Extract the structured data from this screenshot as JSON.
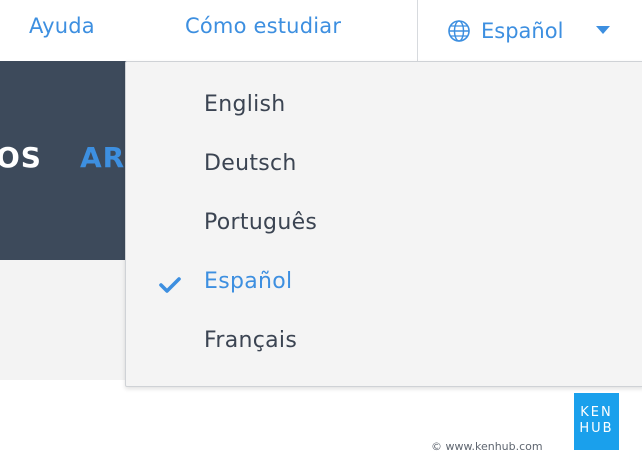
{
  "nav": {
    "items": [
      {
        "label": "Ayuda"
      },
      {
        "label": "Cómo estudiar"
      }
    ],
    "language_button": {
      "label": "Español",
      "icon": "globe-icon",
      "caret_icon": "caret-down-icon"
    }
  },
  "hero": {
    "text_left": "OS",
    "text_right": "AR"
  },
  "language_menu": {
    "options": [
      {
        "label": "English",
        "selected": false
      },
      {
        "label": "Deutsch",
        "selected": false
      },
      {
        "label": "Português",
        "selected": false
      },
      {
        "label": "Español",
        "selected": true
      },
      {
        "label": "Français",
        "selected": false
      }
    ],
    "check_icon": "checkmark-icon"
  },
  "footer": {
    "logo_line1": "KEN",
    "logo_line2": "HUB",
    "copyright": "© www.kenhub.com"
  },
  "colors": {
    "accent": "#3d8fe0",
    "hero_bg": "#3d4a5b",
    "menu_bg": "#f4f4f4",
    "logo_bg": "#1aa0ec"
  }
}
